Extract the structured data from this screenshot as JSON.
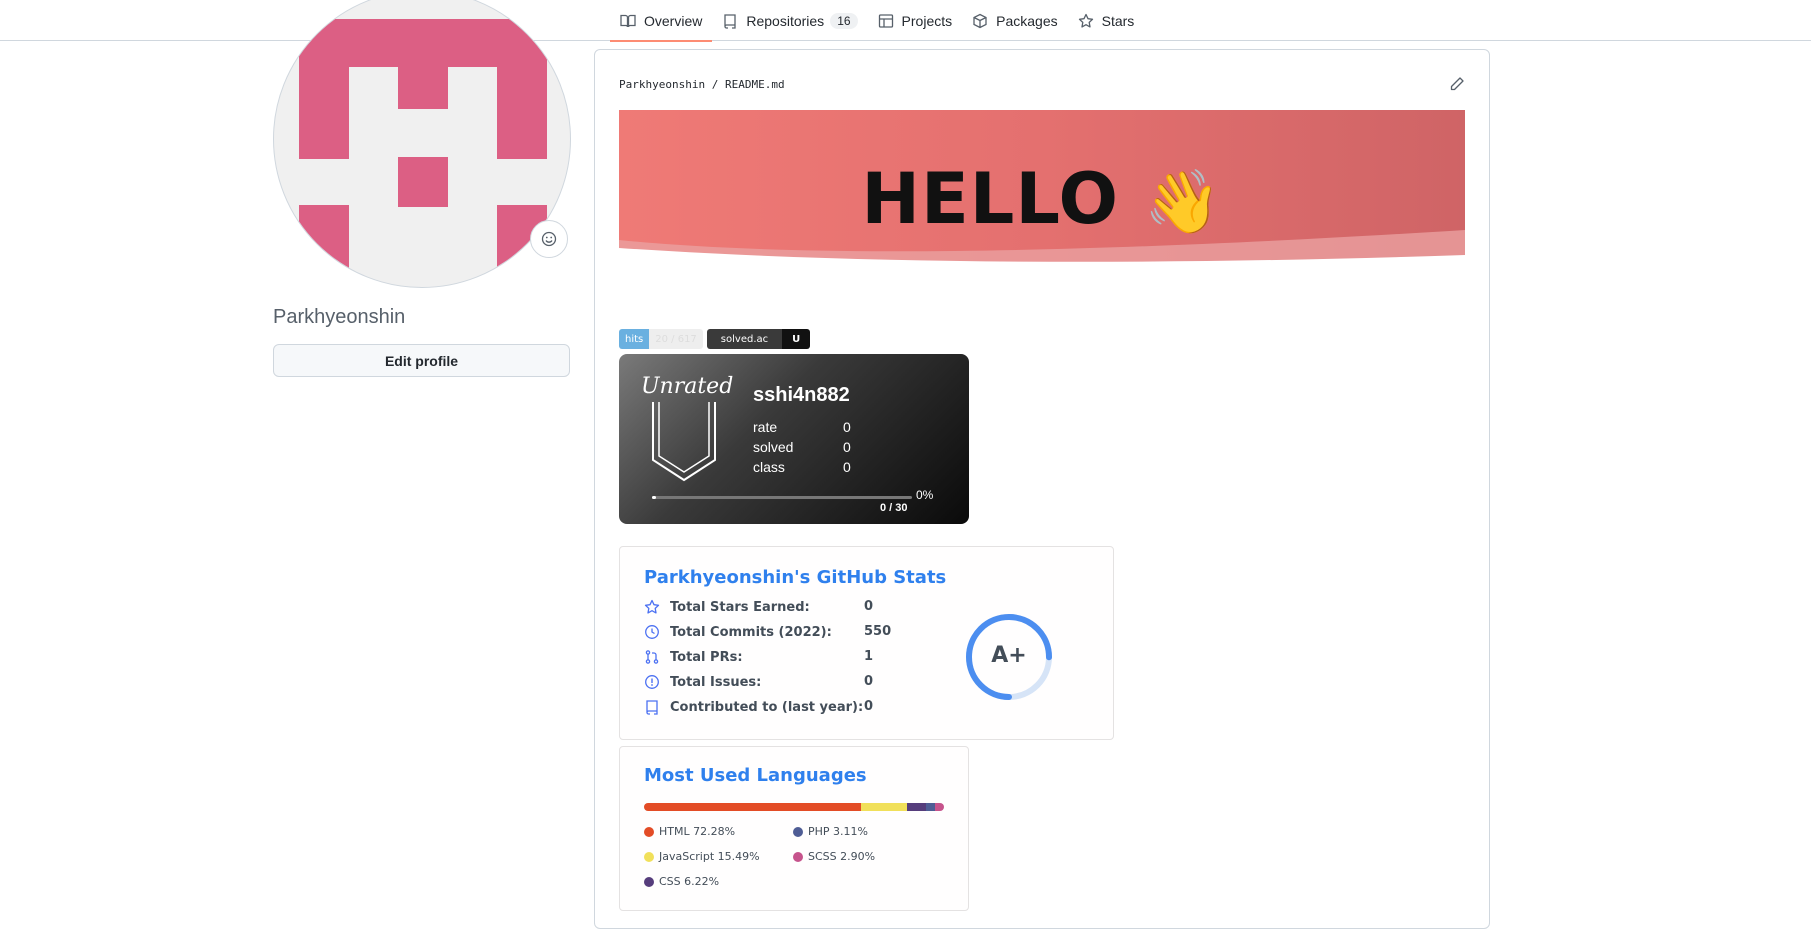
{
  "nav": {
    "tabs": [
      {
        "label": "Overview",
        "icon": "book-icon"
      },
      {
        "label": "Repositories",
        "icon": "repo-icon",
        "count": "16"
      },
      {
        "label": "Projects",
        "icon": "table-icon"
      },
      {
        "label": "Packages",
        "icon": "package-icon"
      },
      {
        "label": "Stars",
        "icon": "star-icon"
      }
    ]
  },
  "profile": {
    "username": "Parkhyeonshin",
    "edit_label": "Edit profile",
    "avatar_color": "#dc5f84"
  },
  "readme": {
    "path": "Parkhyeonshin / README.md",
    "banner_text": "HELLO",
    "banner_emoji": "👋",
    "badges": [
      {
        "left": "hits",
        "right": "20 / 617"
      },
      {
        "left": "solved.ac",
        "right": "U"
      }
    ],
    "solved": {
      "tier": "Unrated",
      "handle": "sshi4n882",
      "rows": [
        {
          "label": "rate",
          "value": "0"
        },
        {
          "label": "solved",
          "value": "0"
        },
        {
          "label": "class",
          "value": "0"
        }
      ],
      "progress_pct": "0%",
      "progress_count": "0 / 30"
    },
    "stats": {
      "title": "Parkhyeonshin's GitHub Stats",
      "rows": [
        {
          "label": "Total Stars Earned:",
          "value": "0",
          "icon": "star-icon"
        },
        {
          "label": "Total Commits (2022):",
          "value": "550",
          "icon": "history-icon"
        },
        {
          "label": "Total PRs:",
          "value": "1",
          "icon": "pr-icon"
        },
        {
          "label": "Total Issues:",
          "value": "0",
          "icon": "issue-icon"
        },
        {
          "label": "Contributed to (last year):",
          "value": "0",
          "icon": "repo-icon"
        }
      ],
      "rank": "A+",
      "rank_progress": 0.75
    },
    "languages": {
      "title": "Most Used Languages",
      "items": [
        {
          "name": "HTML 72.28%",
          "pct": 72.28,
          "color": "#e34c26"
        },
        {
          "name": "JavaScript 15.49%",
          "pct": 15.49,
          "color": "#f1e05a"
        },
        {
          "name": "CSS 6.22%",
          "pct": 6.22,
          "color": "#563d7c"
        },
        {
          "name": "PHP 3.11%",
          "pct": 3.11,
          "color": "#4F5D95"
        },
        {
          "name": "SCSS 2.90%",
          "pct": 2.9,
          "color": "#c6538c"
        }
      ]
    }
  }
}
